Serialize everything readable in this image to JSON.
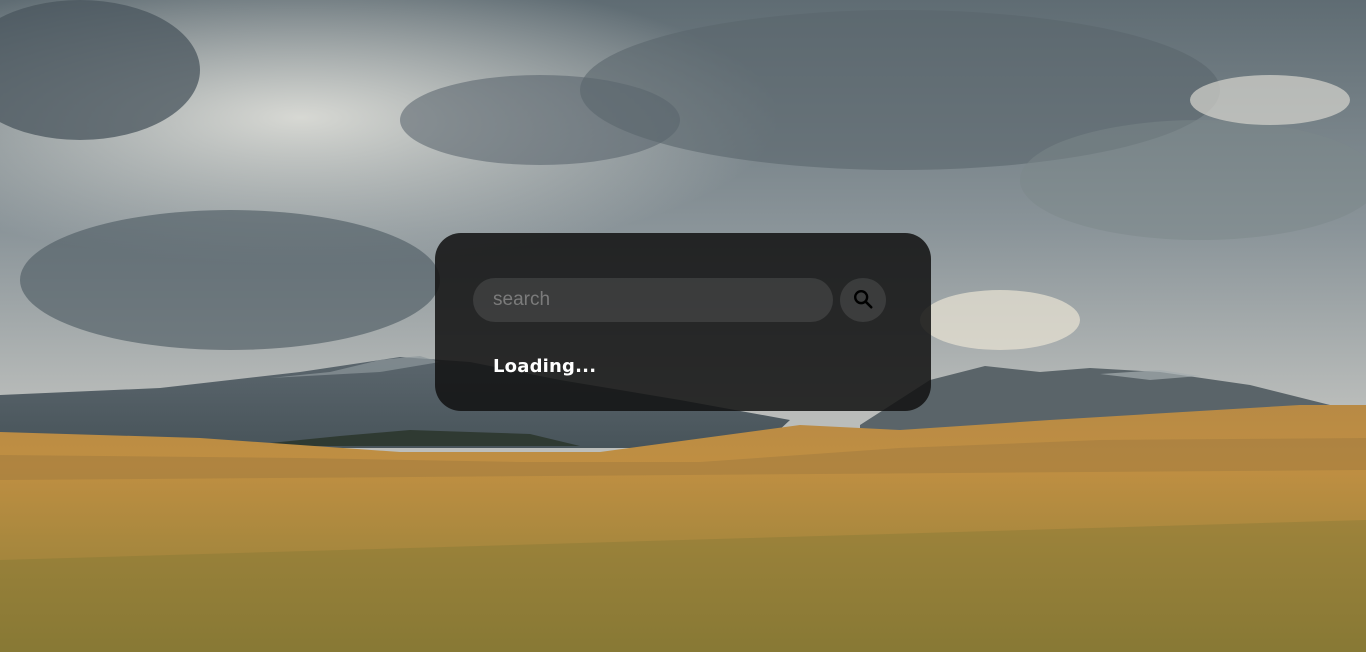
{
  "search": {
    "placeholder": "search",
    "value": ""
  },
  "search_button": {
    "icon": "search-icon"
  },
  "status": {
    "loading_text": "Loading..."
  },
  "colors": {
    "card_background": "#121111",
    "loading_text": "#ffffff",
    "placeholder_text": "#7b7b7b"
  }
}
